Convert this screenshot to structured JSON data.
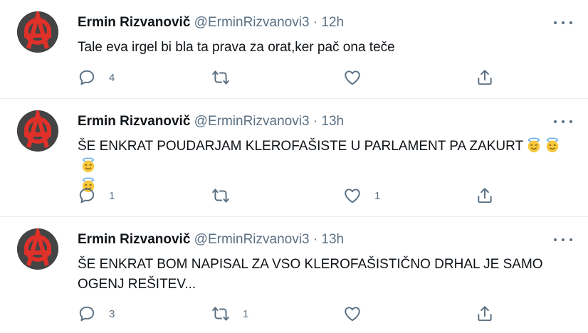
{
  "tweets": [
    {
      "name": "Ermin Rizvanovič",
      "handle": "@ErminRizvanovi3",
      "separator": "·",
      "time": "12h",
      "text": "Tale eva irgel bi bla ta prava za orat,ker pač ona teče",
      "emojis": [],
      "replies": "4",
      "retweets": "",
      "likes": ""
    },
    {
      "name": "Ermin Rizvanovič",
      "handle": "@ErminRizvanovi3",
      "separator": "·",
      "time": "13h",
      "text": "ŠE ENKRAT POUDARJAM KLEROFAŠISTE U PARLAMENT PA ZAKURT",
      "emojis": [
        "smiling-face-with-halo",
        "smiling-face-with-halo",
        "smiling-face-with-halo",
        "smiling-face-with-halo"
      ],
      "replies": "1",
      "retweets": "",
      "likes": "1"
    },
    {
      "name": "Ermin Rizvanovič",
      "handle": "@ErminRizvanovi3",
      "separator": "·",
      "time": "13h",
      "text": "ŠE ENKRAT BOM NAPISAL ZA VSO KLEROFAŠISTIČNO DRHAL JE SAMO OGENJ REŠITEV...",
      "emojis": [],
      "replies": "3",
      "retweets": "1",
      "likes": ""
    }
  ],
  "icons": {
    "avatar": "anarchy-symbol-avatar",
    "more": "more-horizontal-icon",
    "reply": "reply-icon",
    "retweet": "retweet-icon",
    "like": "heart-icon",
    "share": "share-icon"
  },
  "colors": {
    "text": "#0f1419",
    "secondary": "#5b7083",
    "divider": "#ebeef0",
    "avatar_red": "#e0302a"
  }
}
